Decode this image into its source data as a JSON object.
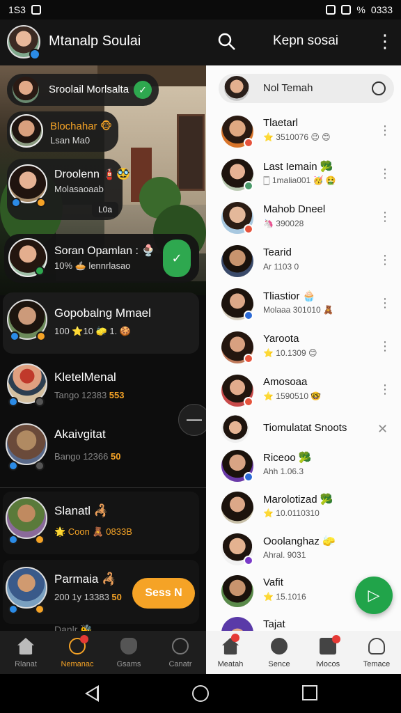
{
  "status_bar": {
    "time": "1S3",
    "right_text": "% ",
    "clock": "0333"
  },
  "app_bar": {
    "title": "Mtanalp Soulai",
    "right_title": "Kepn sosai",
    "more": "⋮"
  },
  "left_chats": [
    {
      "name": "Sroolail Morlsalta",
      "sub": ""
    },
    {
      "name": "Blochahar 🐵",
      "sub": "Lsan Ma0"
    },
    {
      "name": "Droolenn 🧯🥸",
      "sub": "Molasaoaab",
      "extra": "L0a"
    },
    {
      "name": "Soran Opamlan : 🍨",
      "sub": "10% 🥧 lennrlasao"
    },
    {
      "name": "Gopobalng Mmael",
      "sub": "100 ⭐10 🧽 1. 🍪"
    },
    {
      "name": "KletelMenal",
      "sub": "Tango 12383 ",
      "highlight": "553"
    },
    {
      "name": "Akaivgitat",
      "sub": "Bango 12366 ",
      "highlight": "50"
    },
    {
      "name": "Slanatl 🦂",
      "sub": "🌟 Coon 🧸 0833B",
      "highlight": ""
    },
    {
      "name": "Parmaia 🦂",
      "sub": "200 1y 13383 ",
      "highlight": "50"
    },
    {
      "name": "Danlr 🐝",
      "sub": ""
    }
  ],
  "cta_label": "Sess N",
  "drawer_handle": "—",
  "search": {
    "label": "Nol Temah"
  },
  "contacts": [
    {
      "name": "Tlaetarl",
      "sub": "⭐ 3510076 😉 😊"
    },
    {
      "name": "Last Iemain 🥦",
      "sub": "🀆 1malia001 🥳 🤮"
    },
    {
      "name": "Mahob Dneel",
      "sub": "🦄 390028"
    },
    {
      "name": "Tearid",
      "sub": "Ar 1103 0"
    },
    {
      "name": "Tliastior 🧁",
      "sub": "Molaaa 301010 🧸"
    },
    {
      "name": "Yaroota",
      "sub": "⭐ 10.1309 😊"
    },
    {
      "name": "Amosoaa",
      "sub": "⭐ 1590510 🤓"
    },
    {
      "name": "Tiomulatat Snoots",
      "sub": ""
    },
    {
      "name": "Riceoo 🥦",
      "sub": "Ahh 1.06.3"
    },
    {
      "name": "Marolotizad 🥦",
      "sub": "⭐ 10.0110310"
    },
    {
      "name": "Ooolanghaz 🧽",
      "sub": "Ahral. 9031"
    },
    {
      "name": "Vafit",
      "sub": "⭐ 15.1016"
    },
    {
      "name": "Tajat",
      "sub": ""
    }
  ],
  "contact_more": "⋮",
  "contact_close": "✕",
  "fab_icon": "▷",
  "nav_left": [
    {
      "label": "Rlanat",
      "icon": "home-icon"
    },
    {
      "label": "Nemanac",
      "icon": "verified-icon",
      "active": true
    },
    {
      "label": "Gsams",
      "icon": "mask-icon"
    },
    {
      "label": "Canatr",
      "icon": "search-icon"
    }
  ],
  "nav_right": [
    {
      "label": "Meatah",
      "icon": "home-icon"
    },
    {
      "label": "Sence",
      "icon": "gear-icon"
    },
    {
      "label": "Ivlocos",
      "icon": "inbox-icon"
    },
    {
      "label": "Temace",
      "icon": "person-icon"
    }
  ],
  "colors": {
    "accent_orange": "#f5a326",
    "accent_green": "#2ea84f",
    "dark_bg": "#0d0d0d",
    "light_bg": "#fbfbfb"
  }
}
